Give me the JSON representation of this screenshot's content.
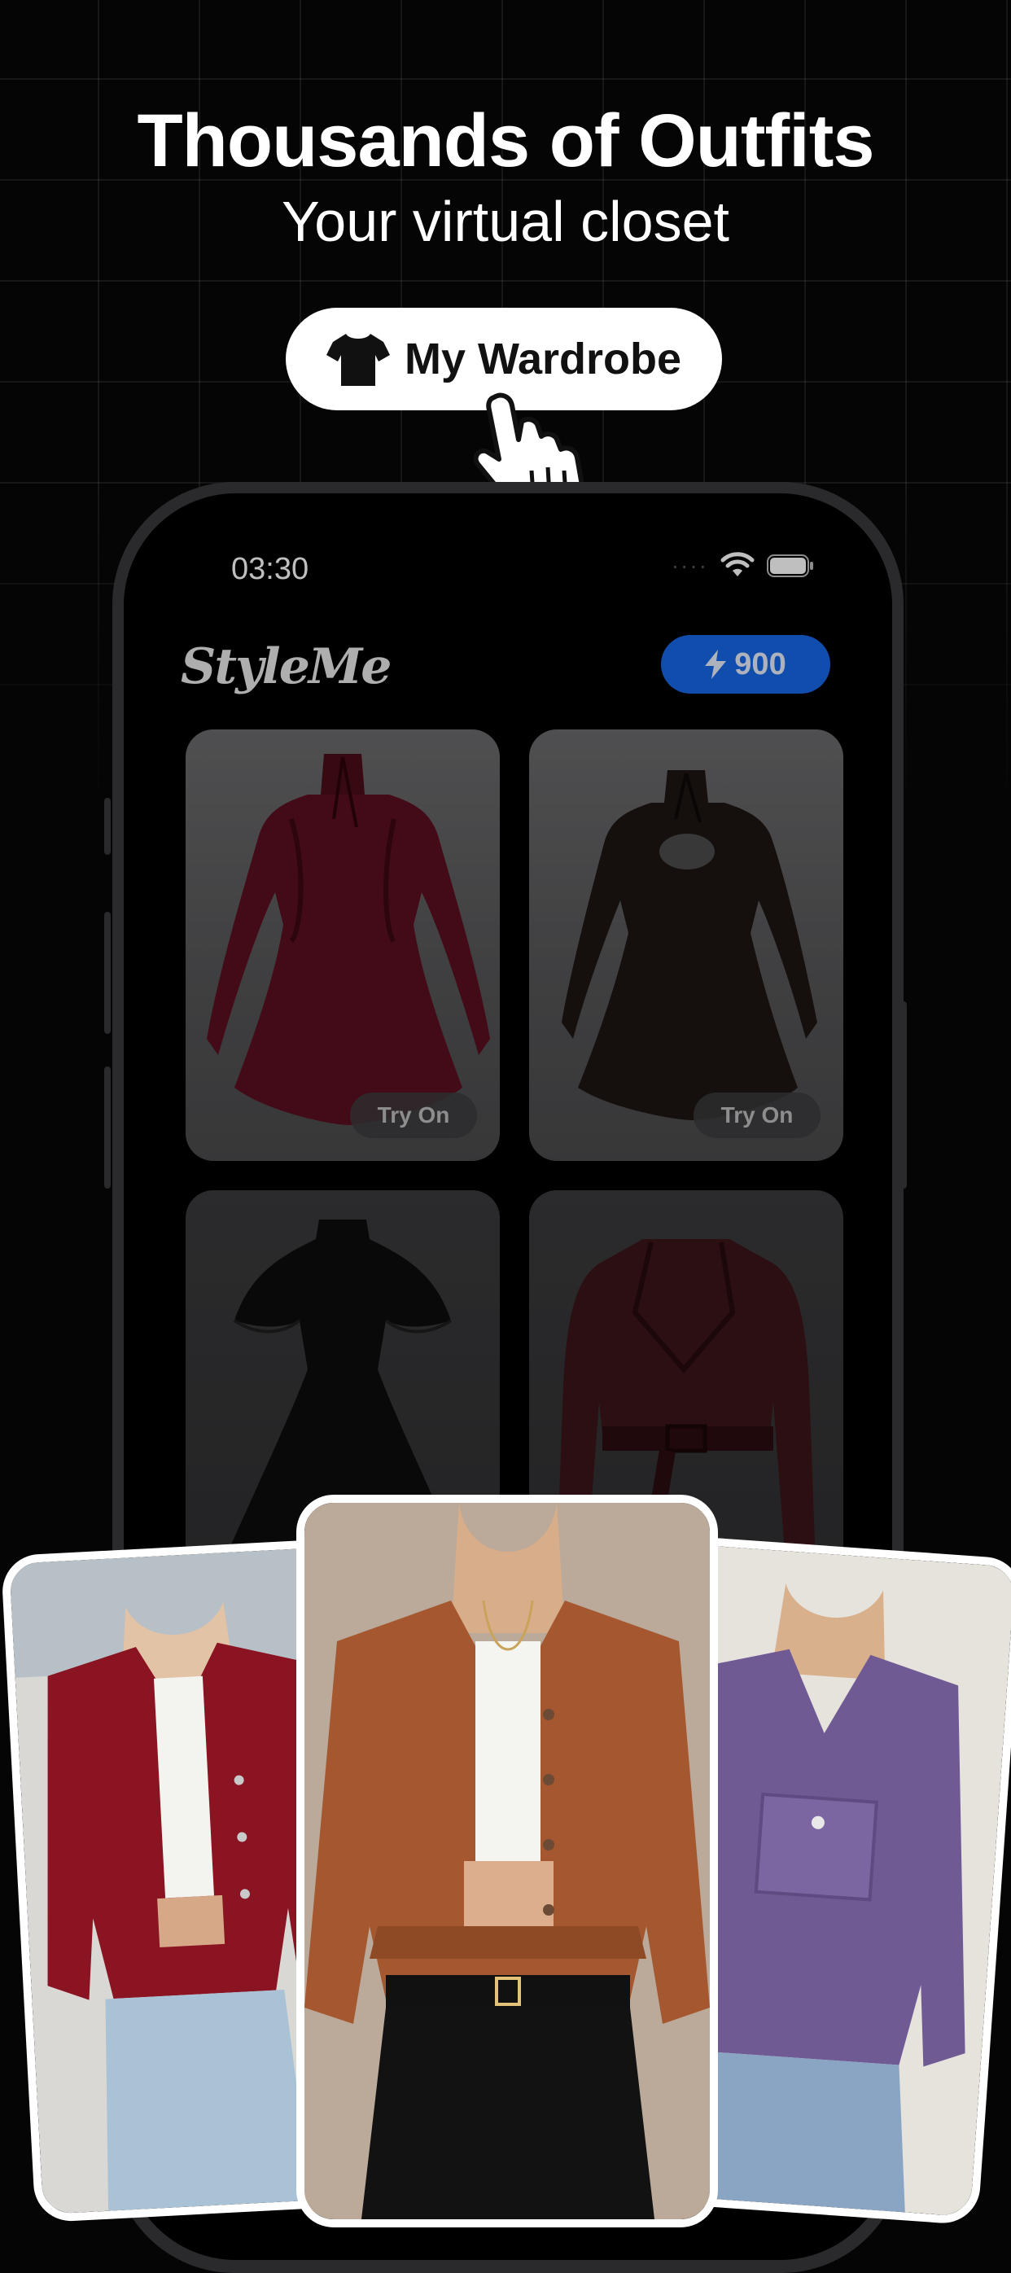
{
  "hero": {
    "title": "Thousands of Outfits",
    "subtitle": "Your virtual closet",
    "button_label": "My Wardrobe",
    "button_icon": "tshirt-icon",
    "pointer_icon": "hand-pointer-icon"
  },
  "phone": {
    "status": {
      "time": "03:30",
      "signal": "····",
      "wifi_icon": "wifi-icon",
      "battery_icon": "battery-icon"
    },
    "app": {
      "logo": "StyleMe",
      "credits": "900",
      "credits_icon": "lightning-icon",
      "accent": "#1767e6"
    },
    "grid": [
      {
        "name": "burgundy-velvet-dress",
        "try_on": "Try On",
        "color": "#5a0f1f"
      },
      {
        "name": "black-cutout-dress",
        "try_on": "Try On",
        "color": "#1c1412"
      },
      {
        "name": "black-cape-dress",
        "try_on": "",
        "color": "#0c0c0c"
      },
      {
        "name": "burgundy-leather-jacket",
        "try_on": "",
        "color": "#3a1418"
      }
    ]
  },
  "showcase": [
    {
      "name": "red-corduroy-jacket",
      "color": "#8a1422"
    },
    {
      "name": "rust-corduroy-jacket",
      "color": "#a5582f"
    },
    {
      "name": "purple-corduroy-jacket",
      "color": "#6f5a94"
    }
  ]
}
